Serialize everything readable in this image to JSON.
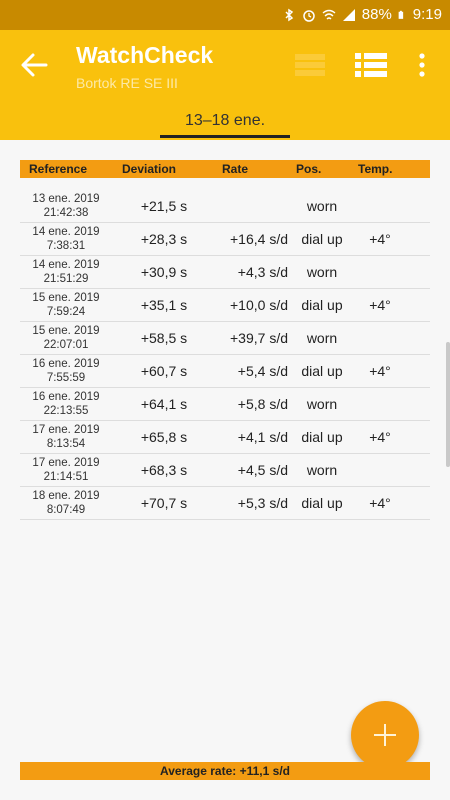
{
  "status_bar": {
    "battery": "88%",
    "time": "9:19"
  },
  "app_bar": {
    "title": "WatchCheck",
    "subtitle": "Bortok RE SE III"
  },
  "tabs": [
    {
      "label": "13–18 ene.",
      "selected": true
    }
  ],
  "table": {
    "headers": [
      "Reference",
      "Deviation",
      "Rate",
      "Pos.",
      "Temp."
    ],
    "rows": [
      {
        "date": "13 ene. 2019",
        "time": "21:42:38",
        "deviation": "+21,5 s",
        "rate": "",
        "position": "worn",
        "temp": ""
      },
      {
        "date": "14 ene. 2019",
        "time": "7:38:31",
        "deviation": "+28,3 s",
        "rate": "+16,4 s/d",
        "position": "dial up",
        "temp": "+4°"
      },
      {
        "date": "14 ene. 2019",
        "time": "21:51:29",
        "deviation": "+30,9 s",
        "rate": "+4,3 s/d",
        "position": "worn",
        "temp": ""
      },
      {
        "date": "15 ene. 2019",
        "time": "7:59:24",
        "deviation": "+35,1 s",
        "rate": "+10,0 s/d",
        "position": "dial up",
        "temp": "+4°"
      },
      {
        "date": "15 ene. 2019",
        "time": "22:07:01",
        "deviation": "+58,5 s",
        "rate": "+39,7 s/d",
        "position": "worn",
        "temp": ""
      },
      {
        "date": "16 ene. 2019",
        "time": "7:55:59",
        "deviation": "+60,7 s",
        "rate": "+5,4 s/d",
        "position": "dial up",
        "temp": "+4°"
      },
      {
        "date": "16 ene. 2019",
        "time": "22:13:55",
        "deviation": "+64,1 s",
        "rate": "+5,8 s/d",
        "position": "worn",
        "temp": ""
      },
      {
        "date": "17 ene. 2019",
        "time": "8:13:54",
        "deviation": "+65,8 s",
        "rate": "+4,1 s/d",
        "position": "dial up",
        "temp": "+4°"
      },
      {
        "date": "17 ene. 2019",
        "time": "21:14:51",
        "deviation": "+68,3 s",
        "rate": "+4,5 s/d",
        "position": "worn",
        "temp": ""
      },
      {
        "date": "18 ene. 2019",
        "time": "8:07:49",
        "deviation": "+70,7 s",
        "rate": "+5,3 s/d",
        "position": "dial up",
        "temp": "+4°"
      }
    ]
  },
  "footer": {
    "average_rate": "Average rate: +11,1 s/d"
  },
  "icons": {
    "back": "arrow-left-icon",
    "list_faded": "list-icon",
    "list": "list-icon",
    "more": "more-vert-icon",
    "add": "plus-icon"
  },
  "colors": {
    "status_bar": "#c88a00",
    "app_bar": "#f9c10d",
    "accent": "#f39c12"
  }
}
